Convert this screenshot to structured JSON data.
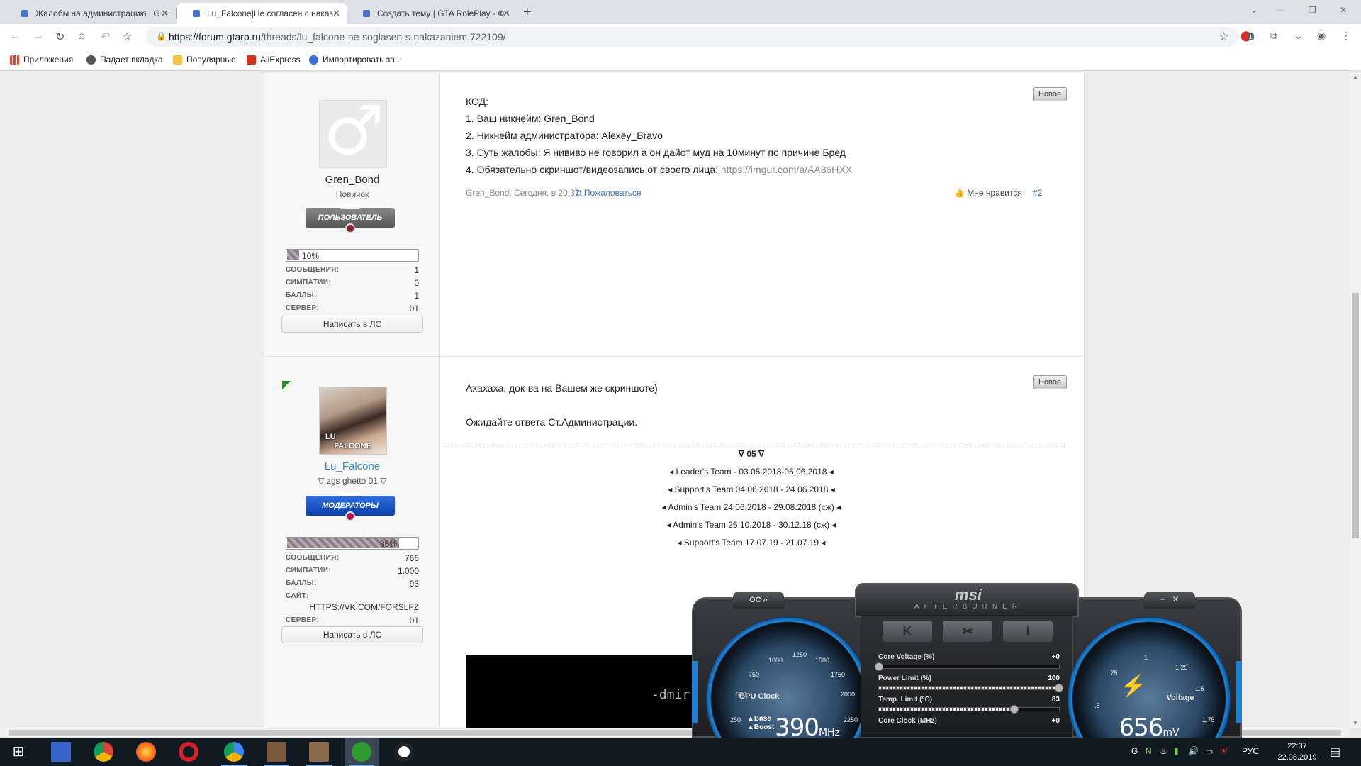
{
  "browser": {
    "tabs": [
      {
        "title": "Жалобы на администрацию | G",
        "close": "✕"
      },
      {
        "title": "Lu_Falcone|Не согласен с наказ",
        "close": "✕"
      },
      {
        "title": "Создать тему | GTA RolePlay - Ф",
        "close": "✕"
      }
    ],
    "new_tab": "+",
    "window_controls": {
      "dropdown": "⌄",
      "minimize": "—",
      "restore": "❐",
      "close": "✕"
    },
    "url": {
      "scheme_host": "https://forum.gtarp.ru",
      "path": "/threads/lu_falcone-ne-soglasen-s-nakazaniem.722109/"
    },
    "extension_badge": "1",
    "bookmarks": [
      {
        "label": "Приложения",
        "color": "#e94235"
      },
      {
        "label": "Падает вкладка",
        "color": "#555555"
      },
      {
        "label": "Популярные",
        "color": "#f4c542"
      },
      {
        "label": "AliExpress",
        "color": "#d9301c"
      },
      {
        "label": "Импортировать за...",
        "color": "#3b6fd6"
      }
    ]
  },
  "posts": [
    {
      "new_badge": "Новое",
      "author": {
        "name": "Gren_Bond",
        "title": "Новичок",
        "ribbon": "ПОЛЬЗОВАТЕЛЬ",
        "progress": 0.1,
        "progress_label": "10%",
        "stats": [
          {
            "label": "СООБЩЕНИЯ:",
            "value": "1"
          },
          {
            "label": "СИМПАТИИ:",
            "value": "0"
          },
          {
            "label": "БАЛЛЫ:",
            "value": "1"
          },
          {
            "label": "СЕРВЕР:",
            "value": "01"
          }
        ],
        "pm_button": "Написать в ЛС"
      },
      "lines": [
        "КОД:",
        "1. Ваш никнейм: Gren_Bond",
        "2. Никнейм администратора: Alexey_Bravo",
        "3. Суть жалобы: Я нививо не говорил а он дайот муд на 10минут по причине Бред",
        "4. Обязательно скриншот/видеозапись от своего лица: "
      ],
      "link": "https://imgur.com/a/AA86HXX",
      "meta": "Gren_Bond, Сегодня, в 20:37",
      "report": "Пожаловаться",
      "like": "Мне нравится",
      "number": "#2"
    },
    {
      "new_badge": "Новое",
      "author": {
        "name": "Lu_Falcone",
        "avatar_text": "LU\nFALCONE",
        "title": "▽ zgs ghetto 01 ▽",
        "ribbon": "МОДЕРАТОРЫ",
        "progress": 0.86,
        "progress_label": "86%",
        "stats": [
          {
            "label": "СООБЩЕНИЯ:",
            "value": "766"
          },
          {
            "label": "СИМПАТИИ:",
            "value": "1.000"
          },
          {
            "label": "БАЛЛЫ:",
            "value": "93"
          },
          {
            "label": "САЙТ:",
            "value": ""
          },
          {
            "label": "СЕРВЕР:",
            "value": "01"
          }
        ],
        "site": "HTTPS://VK.COM/FORSLFZ",
        "pm_button": "Написать в ЛС"
      },
      "lines": [
        "Ахахаха, док-ва на Вашем же скриншоте)",
        "Ожидайте ответа Ст.Администрации."
      ],
      "signature": [
        "ᐁ 05 ᐁ",
        "◂ Leader's Team - 03.05.2018-05.06.2018 ◂",
        "◂ Support's Team 04.06.2018 - 24.06.2018 ◂",
        "◂ Admin's Team 24.06.2018 - 29.08.2018 (сж) ◂",
        "◂ Admin's Team 26.10.2018 - 30.12.18 (сж) ◂",
        "◂ Support's Team 17.07.19 - 21.07.19 ◂"
      ],
      "embed_text": "-dmir"
    }
  ],
  "afterburner": {
    "brand": "msi",
    "product": "AFTERBURNER",
    "oc_button": "OC",
    "buttons": [
      "K",
      "✂",
      "i"
    ],
    "gpu_gauge": {
      "label": "GPU Clock",
      "value": "390",
      "unit": "MHz",
      "base": "▲Base",
      "boost": "▲Boost",
      "ticks": [
        "250",
        "500",
        "750",
        "1000",
        "1250",
        "1500",
        "1750",
        "2000",
        "2250"
      ]
    },
    "voltage_gauge": {
      "label": "Voltage",
      "value": "656",
      "unit": "mV",
      "ticks": [
        ".5",
        ".75",
        "1",
        "1.25",
        "1.5",
        "1.75"
      ]
    },
    "sliders": [
      {
        "name": "Core Voltage (%)",
        "value": "+0",
        "level": 0
      },
      {
        "name": "Power Limit (%)",
        "value": "100",
        "level": 1
      },
      {
        "name": "Temp. Limit (°C)",
        "value": "83",
        "level": 0.75
      },
      {
        "name": "Core Clock (MHz)",
        "value": "+0",
        "level": 0.5
      }
    ]
  },
  "taskbar": {
    "apps": [
      {
        "name": "start",
        "color": "#ffffff"
      },
      {
        "name": "save",
        "color": "#3a63c8"
      },
      {
        "name": "chrome",
        "color": "#e5a321"
      },
      {
        "name": "firefox",
        "color": "#ff6a16"
      },
      {
        "name": "opera",
        "color": "#d61f26"
      },
      {
        "name": "chrome-open",
        "color": "#4286f4"
      },
      {
        "name": "game-1",
        "color": "#7a5a3a"
      },
      {
        "name": "game-2",
        "color": "#8a6a4a"
      },
      {
        "name": "xbox",
        "color": "#2f9a2f"
      },
      {
        "name": "logitech",
        "color": "#222222"
      }
    ],
    "tray": [
      "G",
      "N",
      "♨",
      "▮",
      "🔊",
      "▭",
      "⛨"
    ],
    "lang": "РУС",
    "time": "22:37",
    "date": "22.08.2019"
  }
}
